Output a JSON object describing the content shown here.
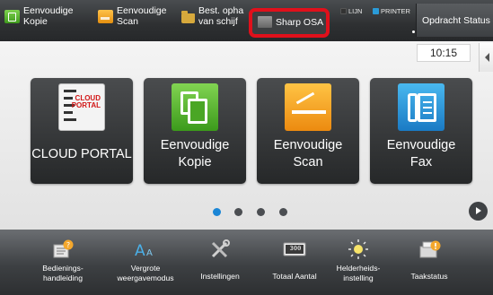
{
  "top_bar": {
    "shortcuts": [
      {
        "label": "Eenvoudige\nKopie",
        "icon": "copy-icon"
      },
      {
        "label": "Eenvoudige\nScan",
        "icon": "scan-icon"
      },
      {
        "label": "Best. opha\nvan schijf",
        "icon": "folder-icon"
      },
      {
        "label": "Sharp OSA",
        "icon": "osa-icon"
      }
    ],
    "cut_letter": "h",
    "indicators": {
      "line": "LIJN",
      "printer": "PRINTER"
    },
    "status_button": "Opdracht Status",
    "highlight_color": "#e0101b"
  },
  "main": {
    "clock": "10:15",
    "tiles": [
      {
        "label": "CLOUD PORTAL",
        "icon": "cloud-portal-icon",
        "logo_text": "CLOUD\nPORTAL"
      },
      {
        "label": "Eenvoudige\nKopie",
        "icon": "copy-icon"
      },
      {
        "label": "Eenvoudige\nScan",
        "icon": "scan-icon"
      },
      {
        "label": "Eenvoudige\nFax",
        "icon": "fax-icon"
      }
    ],
    "pagination": {
      "pages": 4,
      "current": 1
    }
  },
  "bottom_bar": {
    "items": [
      {
        "label": "Bedienings-\nhandleiding",
        "icon": "manual-icon"
      },
      {
        "label": "Vergrote\nweergavemodus",
        "icon": "enlarge-display-icon"
      },
      {
        "label": "Instellingen",
        "icon": "settings-icon"
      },
      {
        "label": "Totaal Aantal",
        "icon": "counter-icon",
        "counter": "300"
      },
      {
        "label": "Helderheids-\ninstelling",
        "icon": "brightness-icon"
      },
      {
        "label": "Taakstatus",
        "icon": "job-status-icon"
      }
    ]
  }
}
